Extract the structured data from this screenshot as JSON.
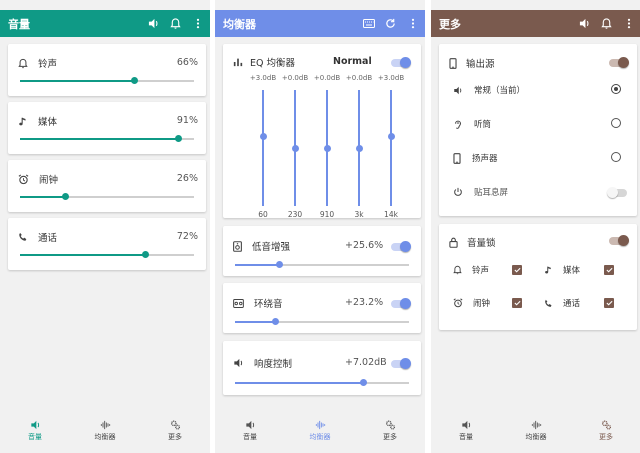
{
  "colors": {
    "volume": "#0f9a86",
    "equalizer": "#6f8ee8",
    "more": "#7a5a4e"
  },
  "volume_panel": {
    "title": "音量",
    "toolbar_icons": [
      "speaker-icon",
      "bell-icon",
      "more-vert-icon"
    ],
    "items": [
      {
        "label": "铃声",
        "icon": "bell-icon",
        "percent": "66%",
        "level": 0.66
      },
      {
        "label": "媒体",
        "icon": "music-note-icon",
        "percent": "91%",
        "level": 0.91
      },
      {
        "label": "闹钟",
        "icon": "alarm-icon",
        "percent": "26%",
        "level": 0.26
      },
      {
        "label": "通话",
        "icon": "phone-icon",
        "percent": "72%",
        "level": 0.72
      }
    ]
  },
  "eq_panel": {
    "title": "均衡器",
    "toolbar_icons": [
      "keyboard-icon",
      "refresh-icon",
      "more-vert-icon"
    ],
    "eq": {
      "label": "EQ 均衡器",
      "preset": "Normal",
      "enabled": true,
      "bands": [
        {
          "gain": "+3.0dB",
          "freq": "60",
          "value": 3.0
        },
        {
          "gain": "+0.0dB",
          "freq": "230",
          "value": 0.0
        },
        {
          "gain": "+0.0dB",
          "freq": "910",
          "value": 0.0
        },
        {
          "gain": "+0.0dB",
          "freq": "3k",
          "value": 0.0
        },
        {
          "gain": "+3.0dB",
          "freq": "14k",
          "value": 3.0
        }
      ],
      "range_db": [
        -15,
        15
      ]
    },
    "effects": [
      {
        "label": "低音增强",
        "icon": "bass-icon",
        "value": "+25.6%",
        "level": 0.256,
        "enabled": true
      },
      {
        "label": "环绕音",
        "icon": "surround-icon",
        "value": "+23.2%",
        "level": 0.232,
        "enabled": true
      },
      {
        "label": "响度控制",
        "icon": "loudness-icon",
        "value": "+7.02dB",
        "level": 0.74,
        "enabled": true
      }
    ]
  },
  "more_panel": {
    "title": "更多",
    "toolbar_icons": [
      "speaker-icon",
      "bell-icon",
      "more-vert-icon"
    ],
    "output": {
      "label": "输出源",
      "enabled": true,
      "options": [
        {
          "label": "常规（当前）",
          "icon": "speaker-icon",
          "selected": true
        },
        {
          "label": "听筒",
          "icon": "earpiece-icon",
          "selected": false
        },
        {
          "label": "扬声器",
          "icon": "phone-speaker-icon",
          "selected": false
        }
      ],
      "screen_off": {
        "label": "贴耳息屏",
        "icon": "power-icon",
        "enabled": false
      }
    },
    "volume_lock": {
      "label": "音量锁",
      "enabled": true,
      "items": [
        {
          "label": "铃声",
          "icon": "bell-icon",
          "checked": true
        },
        {
          "label": "媒体",
          "icon": "music-note-icon",
          "checked": true
        },
        {
          "label": "闹钟",
          "icon": "alarm-icon",
          "checked": true
        },
        {
          "label": "通话",
          "icon": "phone-icon",
          "checked": true
        }
      ]
    }
  },
  "bottom_nav": [
    {
      "label": "音量",
      "icon": "volume-icon"
    },
    {
      "label": "均衡器",
      "icon": "equalizer-icon"
    },
    {
      "label": "更多",
      "icon": "gears-icon"
    }
  ]
}
